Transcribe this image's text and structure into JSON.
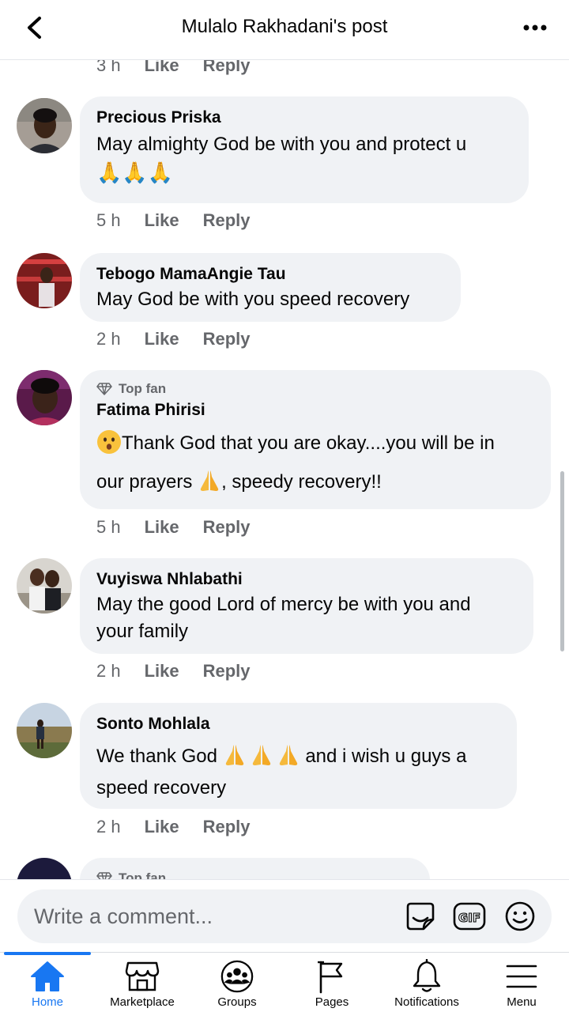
{
  "header": {
    "title": "Mulalo Rakhadani's post"
  },
  "first_meta": {
    "time": "3 h",
    "like": "Like",
    "reply": "Reply"
  },
  "comments": [
    {
      "name": "Precious Priska",
      "text": "May almighty God be with you and protect u",
      "emoji_line": "🙏🙏🙏",
      "time": "5 h",
      "like": "Like",
      "reply": "Reply"
    },
    {
      "name": "Tebogo MamaAngie Tau",
      "text": "May God be with you speed recovery",
      "time": "2 h",
      "like": "Like",
      "reply": "Reply"
    },
    {
      "badge": "Top fan",
      "name": "Fatima Phirisi",
      "text_a": "Thank God that you are okay....you will be in",
      "text_b1": "our prayers ",
      "text_b2": ", speedy recovery!!",
      "time": "5 h",
      "like": "Like",
      "reply": "Reply"
    },
    {
      "name": "Vuyiswa Nhlabathi",
      "text_1": "May the good Lord of mercy be with you and",
      "text_2": "your family",
      "time": "2 h",
      "like": "Like",
      "reply": "Reply"
    },
    {
      "name": "Sonto Mohlala",
      "text_1a": "We thank God ",
      "text_1b": " and i wish u guys a",
      "text_2": "speed recovery",
      "time": "2 h",
      "like": "Like",
      "reply": "Reply"
    },
    {
      "badge": "Top fan"
    }
  ],
  "composer": {
    "placeholder": "Write a comment..."
  },
  "tabs": [
    {
      "label": "Home",
      "icon": "home-icon",
      "active": true
    },
    {
      "label": "Marketplace",
      "icon": "marketplace-icon"
    },
    {
      "label": "Groups",
      "icon": "groups-icon"
    },
    {
      "label": "Pages",
      "icon": "pages-icon"
    },
    {
      "label": "Notifications",
      "icon": "bell-icon"
    },
    {
      "label": "Menu",
      "icon": "menu-icon"
    }
  ],
  "colors": {
    "accent": "#1877f2",
    "bubble": "#f0f2f5",
    "muted": "#65676b"
  }
}
